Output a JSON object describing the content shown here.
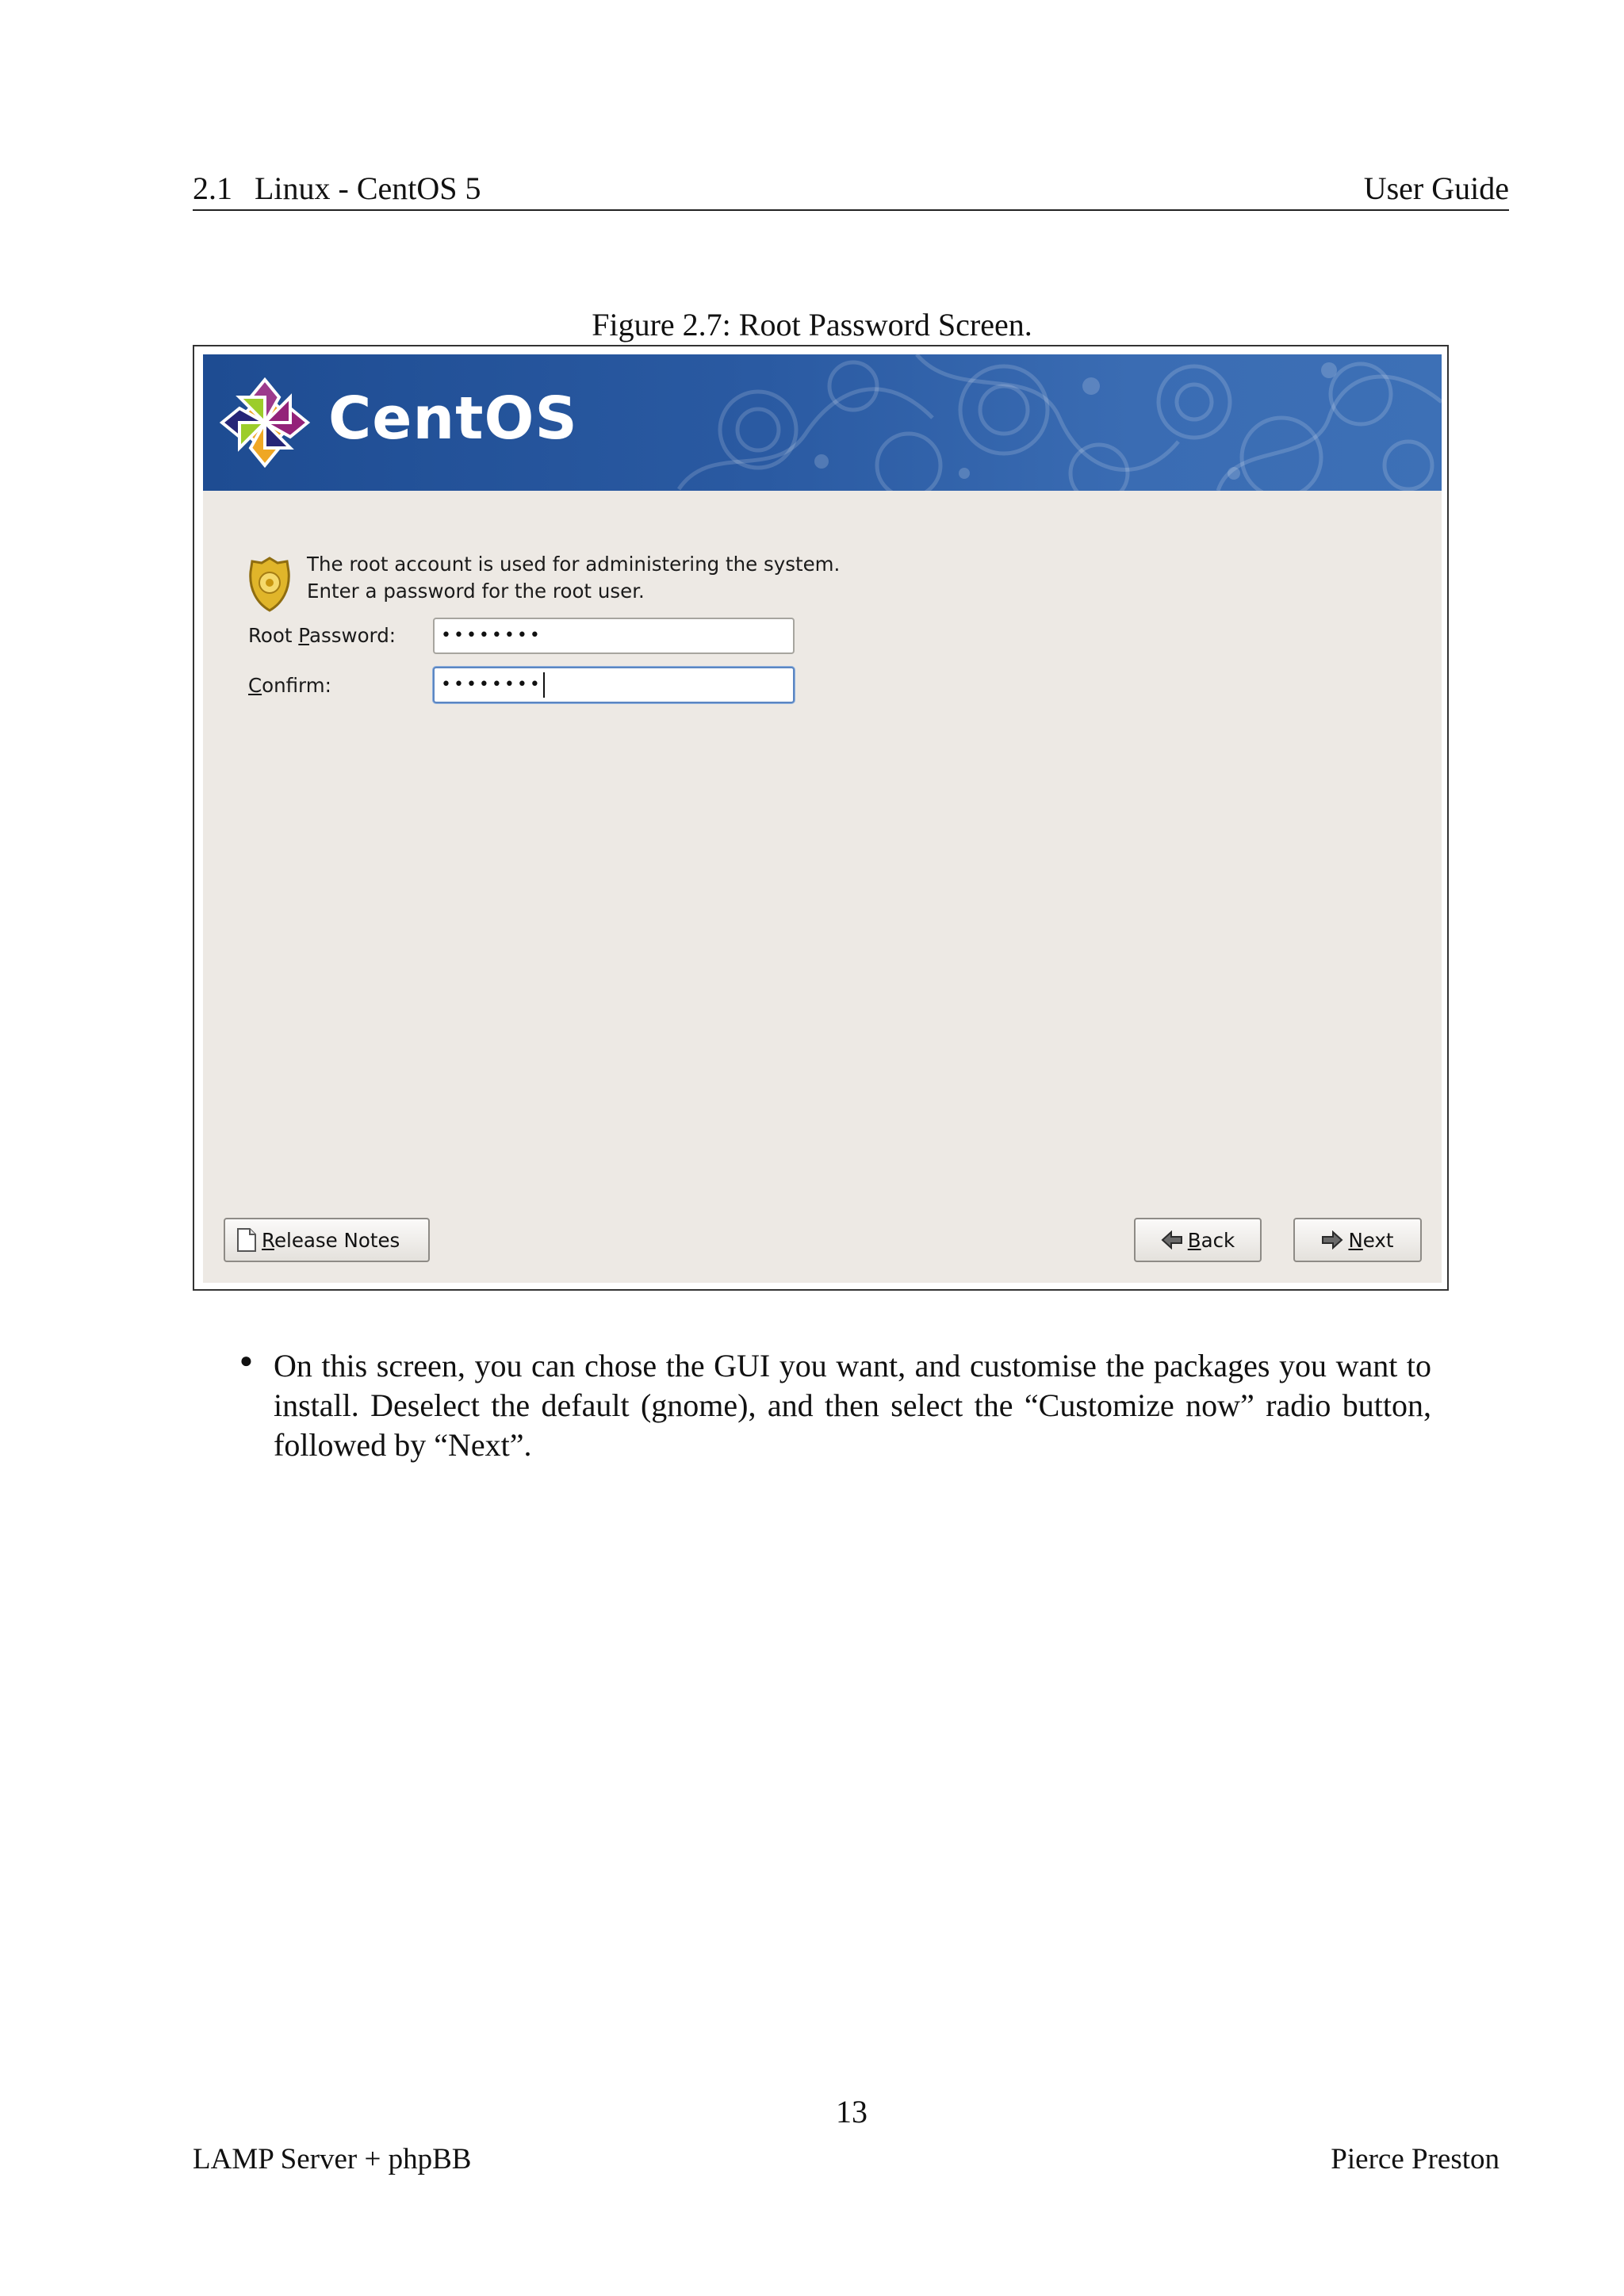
{
  "header": {
    "section_number": "2.1",
    "section_title": "Linux - CentOS 5",
    "right_title": "User Guide"
  },
  "figure": {
    "caption": "Figure 2.7: Root Password Screen.",
    "banner": {
      "logo_text": "CentOS",
      "background_color": "#2a5aa2"
    },
    "info_text": "The root account is used for administering the system.  Enter a password for the root user.",
    "root_password": {
      "label_before": "Root ",
      "label_accel": "P",
      "label_after": "assword:",
      "value": "••••••••"
    },
    "confirm": {
      "label_accel": "C",
      "label_after": "onfirm:",
      "value": "••••••••"
    },
    "buttons": {
      "release_notes": {
        "accel": "R",
        "rest": "elease Notes",
        "icon": "document-icon"
      },
      "back": {
        "accel": "B",
        "rest": "ack",
        "icon": "back-arrow-icon"
      },
      "next": {
        "accel": "N",
        "rest": "ext",
        "icon": "next-arrow-icon"
      }
    }
  },
  "body": {
    "bullet_text": "On this screen, you can chose the GUI you want, and customise the packages you want to install. Deselect the default (gnome), and then select the “Customize now” radio button, followed by “Next”."
  },
  "footer": {
    "page_number": "13",
    "left": "LAMP Server + phpBB",
    "right": "Pierce Preston"
  }
}
